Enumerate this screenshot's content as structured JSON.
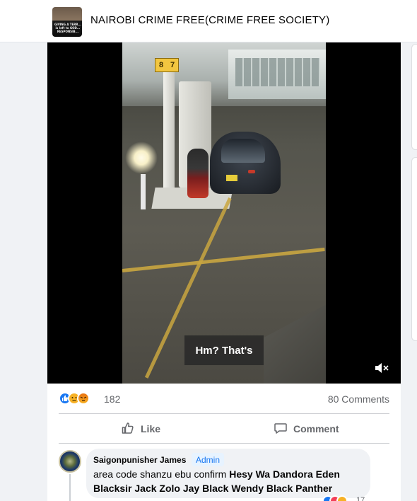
{
  "header": {
    "page_name": "NAIROBI CRIME FREE(CRIME FREE SOCIETY)",
    "avatar_caption": "GIVING A TERR... is left to GOD... RESPONSIB..."
  },
  "video": {
    "caption": "Hm? That's",
    "pump_numbers": [
      "8",
      "7"
    ],
    "mute_icon": "speaker-muted-icon"
  },
  "stats": {
    "reaction_count": "182",
    "comments": "80 Comments",
    "reaction_types": [
      "like",
      "sad",
      "angry"
    ],
    "colors": {
      "like": "#1877f2",
      "sad": "#f7b125",
      "angry": "#e9710f"
    }
  },
  "actions": {
    "like_label": "Like",
    "comment_label": "Comment"
  },
  "comment": {
    "author": "Saigonpunisher James",
    "badge": "Admin",
    "text_plain": "area code shanzu ebu confirm ",
    "tag_1": "Hesy Wa Dandora",
    "tag_2": "Eden",
    "tag_3": "Blacksir Jack",
    "tag_4": "Zolo Jay Black",
    "tag_5": "Wendy Black Panther",
    "reaction_count": "17"
  }
}
